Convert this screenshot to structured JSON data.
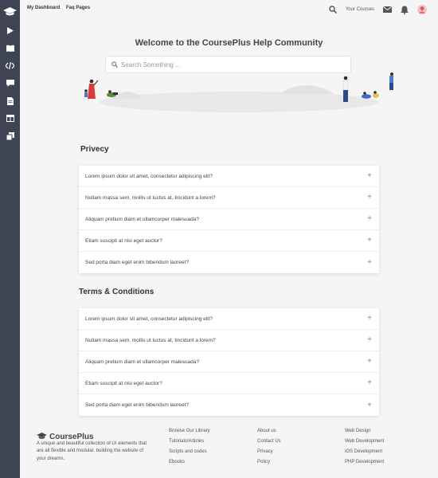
{
  "topbar": {
    "nav": [
      "My Dashboard",
      "Faq Pages"
    ],
    "your_courses": "Your Courses"
  },
  "hero": {
    "title": "Welcome to the CoursePlus Help Community",
    "search_placeholder": "Search Something ..."
  },
  "sections": [
    {
      "title": "Privecy",
      "questions": [
        "Lorem ipsum dolor sit amet, consectetur adipiscing elit?",
        "Nullam massa sem, mollis ut luctus at, tincidunt a lorem?",
        "Aliquam pretium diam et ullamcorper malesuada?",
        "Etiam suscipit at nisi eget auctor?",
        "Sed porta diam eget enim bibendum laoreet?"
      ]
    },
    {
      "title": "Terms & Conditions",
      "questions": [
        "Lorem ipsum dolor sit amet, consectetur adipiscing elit?",
        "Nullam massa sem, mollis ut luctus at, tincidunt a lorem?",
        "Aliquam pretium diam et ullamcorper malesuada?",
        "Etiam suscipit at nisi eget auctor?",
        "Sed porta diam eget enim bibendum laoreet?"
      ]
    }
  ],
  "footer": {
    "brand": "CoursePlus",
    "description": "A unique and beautiful collection of UI elements that are all flexible and modular. building the website of your dreams.",
    "columns": [
      [
        "Browse Our Library",
        "Tutorials/Articles",
        "Scripts and codes",
        "Ebooks"
      ],
      [
        "About us",
        "Contact Us",
        "Privacy",
        "Policy"
      ],
      [
        "Web Design",
        "Web Development",
        "iOS Development",
        "PHP Development"
      ]
    ]
  },
  "icons": {
    "sidebar": [
      "graduation-cap-icon",
      "play-icon",
      "book-icon",
      "code-icon",
      "chat-icon",
      "document-icon",
      "browser-icon",
      "copy-icon"
    ],
    "faq_toggle": "plus-icon",
    "topbar": [
      "search-icon",
      "mail-icon",
      "bell-icon",
      "avatar"
    ]
  },
  "colors": {
    "sidebar_bg": "#3e4451",
    "page_bg": "#f5f5f5",
    "card_bg": "#ffffff"
  }
}
